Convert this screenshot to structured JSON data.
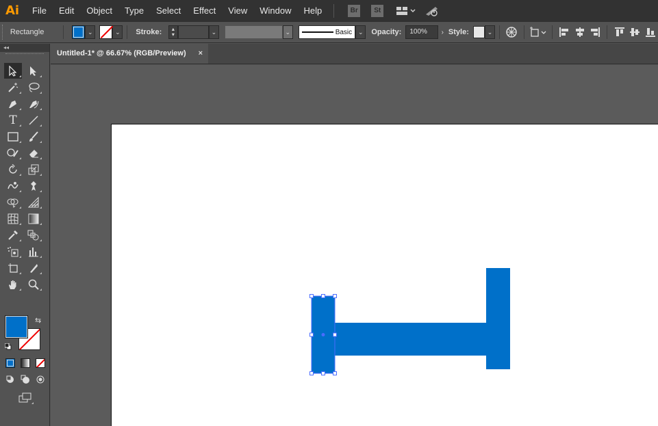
{
  "app": {
    "logo": "Ai",
    "menus": [
      "File",
      "Edit",
      "Object",
      "Type",
      "Select",
      "Effect",
      "View",
      "Window",
      "Help"
    ],
    "bridge_label": "Br",
    "stock_label": "St"
  },
  "control_bar": {
    "object_type": "Rectangle",
    "stroke_label": "Stroke:",
    "brush_label": "Basic",
    "opacity_label": "Opacity:",
    "opacity_value": "100%",
    "style_label": "Style:",
    "fill_color": "#0070c9"
  },
  "document": {
    "tab_title": "Untitled-1* @ 66.67% (RGB/Preview)",
    "close_label": "×"
  },
  "tools": [
    "selection-tool",
    "direct-selection-tool",
    "magic-wand-tool",
    "lasso-tool",
    "pen-tool",
    "curvature-tool",
    "type-tool",
    "line-segment-tool",
    "rectangle-tool",
    "paintbrush-tool",
    "shaper-tool",
    "eraser-tool",
    "rotate-tool",
    "scale-tool",
    "warp-tool",
    "puppet-warp-tool",
    "shape-builder-tool",
    "perspective-grid-tool",
    "mesh-tool",
    "gradient-tool",
    "eyedropper-tool",
    "blend-tool",
    "symbol-sprayer-tool",
    "column-graph-tool",
    "artboard-tool",
    "slice-tool",
    "hand-tool",
    "zoom-tool"
  ],
  "colors": {
    "accent_blue": "#0070c9",
    "selection_blue": "#4a6cff"
  }
}
